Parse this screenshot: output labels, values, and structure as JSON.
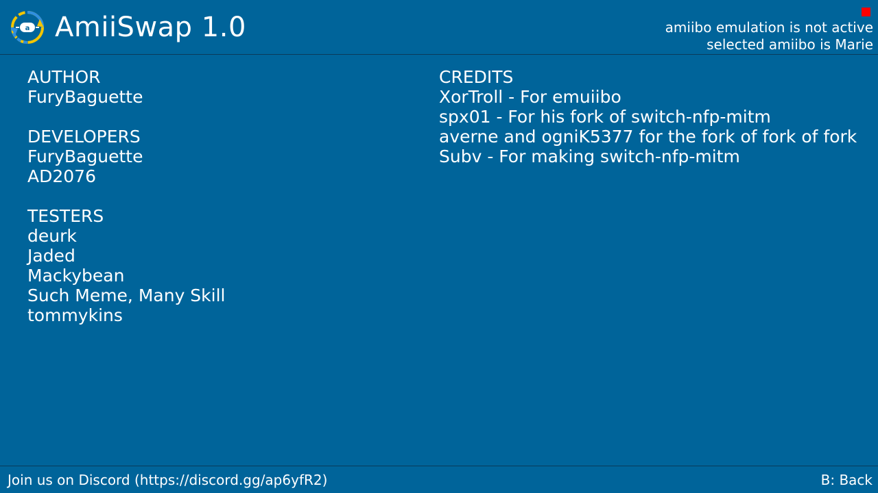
{
  "header": {
    "title": "AmiiSwap 1.0",
    "logo_icon": "amiiswap-logo-icon",
    "status_indicator_color": "#ff0000",
    "status_lines": [
      "amiibo emulation is not active",
      "selected amiibo is Marie"
    ]
  },
  "theme": {
    "background": "#00649a",
    "text": "#ffffff",
    "logo_yellow": "#f2c500",
    "logo_blue": "#2f8fe0"
  },
  "left_column": {
    "sections": [
      {
        "heading": "AUTHOR",
        "items": [
          "FuryBaguette"
        ]
      },
      {
        "heading": "DEVELOPERS",
        "items": [
          "FuryBaguette",
          "AD2076"
        ]
      },
      {
        "heading": "TESTERS",
        "items": [
          "deurk",
          "Jaded",
          "Mackybean",
          "Such Meme, Many Skill",
          "tommykins"
        ]
      }
    ]
  },
  "right_column": {
    "sections": [
      {
        "heading": "CREDITS",
        "items": [
          "XorTroll - For emuiibo",
          "spx01 - For his fork of switch-nfp-mitm",
          "averne and ogniK5377 for the fork of fork of fork",
          "Subv - For making switch-nfp-mitm"
        ]
      }
    ]
  },
  "footer": {
    "discord_label": "Join us on Discord (https://discord.gg/ap6yfR2)",
    "back_label": "B: Back"
  }
}
